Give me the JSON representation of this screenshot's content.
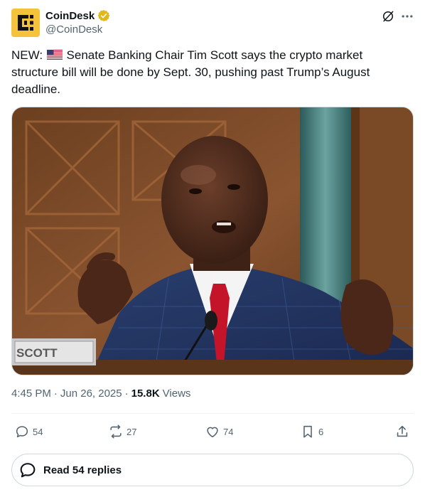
{
  "author": {
    "display_name": "CoinDesk",
    "handle": "@CoinDesk",
    "avatar_icon": "coindesk-logo",
    "verified_color": "#e2b719"
  },
  "tweet": {
    "prefix": "NEW: ",
    "flag_icon": "us-flag",
    "text": " Senate Banking Chair Tim Scott says the crypto market structure bill will be done by Sept. 30, pushing past Trump’s August deadline."
  },
  "media": {
    "nameplate": "SCOTT"
  },
  "meta": {
    "time": "4:45 PM",
    "date": "Jun 26, 2025",
    "views_count": "15.8K",
    "views_label": "Views"
  },
  "actions": {
    "replies": "54",
    "reposts": "27",
    "likes": "74",
    "bookmarks": "6"
  },
  "read_replies": {
    "label": "Read 54 replies"
  },
  "colors": {
    "text": "#0f1419",
    "secondary": "#536471",
    "border": "#cfd9de"
  }
}
